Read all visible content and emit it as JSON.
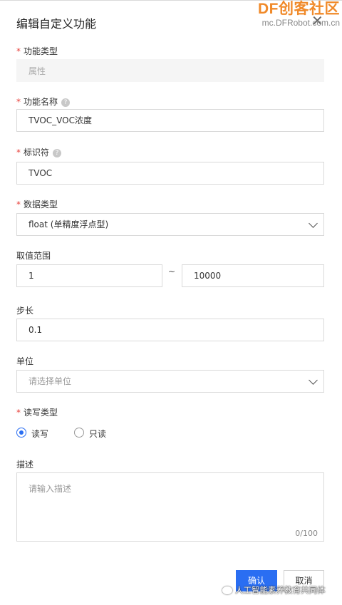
{
  "dialog": {
    "title": "编辑自定义功能",
    "close_glyph": "✕"
  },
  "watermark": {
    "brand": "DF创客社区",
    "url": "mc.DFRobot.com.cn",
    "footer": "人工智能素养教育共同体"
  },
  "form": {
    "required_mark": "*",
    "help_glyph": "?",
    "func_type": {
      "label": "功能类型",
      "value": "属性"
    },
    "func_name": {
      "label": "功能名称",
      "value": "TVOC_VOC浓度"
    },
    "identifier": {
      "label": "标识符",
      "value": "TVOC"
    },
    "data_type": {
      "label": "数据类型",
      "value": "float (单精度浮点型)"
    },
    "range": {
      "label": "取值范围",
      "min": "1",
      "separator": "~",
      "max": "10000"
    },
    "step": {
      "label": "步长",
      "value": "0.1"
    },
    "unit": {
      "label": "单位",
      "placeholder": "请选择单位"
    },
    "rw_type": {
      "label": "读写类型",
      "options": [
        {
          "label": "读写",
          "selected": true
        },
        {
          "label": "只读",
          "selected": false
        }
      ]
    },
    "description": {
      "label": "描述",
      "placeholder": "请输入描述",
      "counter": "0/100"
    }
  },
  "buttons": {
    "confirm": "确认",
    "cancel": "取消"
  },
  "colors": {
    "primary": "#2a6ef2",
    "required": "#e8423c",
    "brand": "#f08a2a"
  },
  "icons": [
    "close-icon",
    "help-icon",
    "chevron-down-icon",
    "wechat-icon"
  ]
}
